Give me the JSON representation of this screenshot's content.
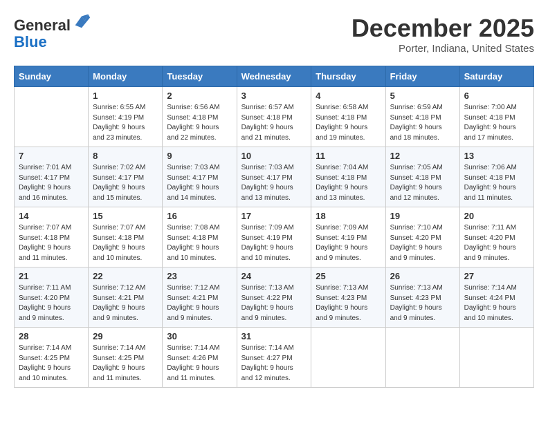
{
  "header": {
    "logo_line1": "General",
    "logo_line2": "Blue",
    "month": "December 2025",
    "location": "Porter, Indiana, United States"
  },
  "days_of_week": [
    "Sunday",
    "Monday",
    "Tuesday",
    "Wednesday",
    "Thursday",
    "Friday",
    "Saturday"
  ],
  "weeks": [
    [
      {
        "day": "",
        "info": ""
      },
      {
        "day": "1",
        "info": "Sunrise: 6:55 AM\nSunset: 4:19 PM\nDaylight: 9 hours\nand 23 minutes."
      },
      {
        "day": "2",
        "info": "Sunrise: 6:56 AM\nSunset: 4:18 PM\nDaylight: 9 hours\nand 22 minutes."
      },
      {
        "day": "3",
        "info": "Sunrise: 6:57 AM\nSunset: 4:18 PM\nDaylight: 9 hours\nand 21 minutes."
      },
      {
        "day": "4",
        "info": "Sunrise: 6:58 AM\nSunset: 4:18 PM\nDaylight: 9 hours\nand 19 minutes."
      },
      {
        "day": "5",
        "info": "Sunrise: 6:59 AM\nSunset: 4:18 PM\nDaylight: 9 hours\nand 18 minutes."
      },
      {
        "day": "6",
        "info": "Sunrise: 7:00 AM\nSunset: 4:18 PM\nDaylight: 9 hours\nand 17 minutes."
      }
    ],
    [
      {
        "day": "7",
        "info": "Sunrise: 7:01 AM\nSunset: 4:17 PM\nDaylight: 9 hours\nand 16 minutes."
      },
      {
        "day": "8",
        "info": "Sunrise: 7:02 AM\nSunset: 4:17 PM\nDaylight: 9 hours\nand 15 minutes."
      },
      {
        "day": "9",
        "info": "Sunrise: 7:03 AM\nSunset: 4:17 PM\nDaylight: 9 hours\nand 14 minutes."
      },
      {
        "day": "10",
        "info": "Sunrise: 7:03 AM\nSunset: 4:17 PM\nDaylight: 9 hours\nand 13 minutes."
      },
      {
        "day": "11",
        "info": "Sunrise: 7:04 AM\nSunset: 4:18 PM\nDaylight: 9 hours\nand 13 minutes."
      },
      {
        "day": "12",
        "info": "Sunrise: 7:05 AM\nSunset: 4:18 PM\nDaylight: 9 hours\nand 12 minutes."
      },
      {
        "day": "13",
        "info": "Sunrise: 7:06 AM\nSunset: 4:18 PM\nDaylight: 9 hours\nand 11 minutes."
      }
    ],
    [
      {
        "day": "14",
        "info": "Sunrise: 7:07 AM\nSunset: 4:18 PM\nDaylight: 9 hours\nand 11 minutes."
      },
      {
        "day": "15",
        "info": "Sunrise: 7:07 AM\nSunset: 4:18 PM\nDaylight: 9 hours\nand 10 minutes."
      },
      {
        "day": "16",
        "info": "Sunrise: 7:08 AM\nSunset: 4:18 PM\nDaylight: 9 hours\nand 10 minutes."
      },
      {
        "day": "17",
        "info": "Sunrise: 7:09 AM\nSunset: 4:19 PM\nDaylight: 9 hours\nand 10 minutes."
      },
      {
        "day": "18",
        "info": "Sunrise: 7:09 AM\nSunset: 4:19 PM\nDaylight: 9 hours\nand 9 minutes."
      },
      {
        "day": "19",
        "info": "Sunrise: 7:10 AM\nSunset: 4:20 PM\nDaylight: 9 hours\nand 9 minutes."
      },
      {
        "day": "20",
        "info": "Sunrise: 7:11 AM\nSunset: 4:20 PM\nDaylight: 9 hours\nand 9 minutes."
      }
    ],
    [
      {
        "day": "21",
        "info": "Sunrise: 7:11 AM\nSunset: 4:20 PM\nDaylight: 9 hours\nand 9 minutes."
      },
      {
        "day": "22",
        "info": "Sunrise: 7:12 AM\nSunset: 4:21 PM\nDaylight: 9 hours\nand 9 minutes."
      },
      {
        "day": "23",
        "info": "Sunrise: 7:12 AM\nSunset: 4:21 PM\nDaylight: 9 hours\nand 9 minutes."
      },
      {
        "day": "24",
        "info": "Sunrise: 7:13 AM\nSunset: 4:22 PM\nDaylight: 9 hours\nand 9 minutes."
      },
      {
        "day": "25",
        "info": "Sunrise: 7:13 AM\nSunset: 4:23 PM\nDaylight: 9 hours\nand 9 minutes."
      },
      {
        "day": "26",
        "info": "Sunrise: 7:13 AM\nSunset: 4:23 PM\nDaylight: 9 hours\nand 9 minutes."
      },
      {
        "day": "27",
        "info": "Sunrise: 7:14 AM\nSunset: 4:24 PM\nDaylight: 9 hours\nand 10 minutes."
      }
    ],
    [
      {
        "day": "28",
        "info": "Sunrise: 7:14 AM\nSunset: 4:25 PM\nDaylight: 9 hours\nand 10 minutes."
      },
      {
        "day": "29",
        "info": "Sunrise: 7:14 AM\nSunset: 4:25 PM\nDaylight: 9 hours\nand 11 minutes."
      },
      {
        "day": "30",
        "info": "Sunrise: 7:14 AM\nSunset: 4:26 PM\nDaylight: 9 hours\nand 11 minutes."
      },
      {
        "day": "31",
        "info": "Sunrise: 7:14 AM\nSunset: 4:27 PM\nDaylight: 9 hours\nand 12 minutes."
      },
      {
        "day": "",
        "info": ""
      },
      {
        "day": "",
        "info": ""
      },
      {
        "day": "",
        "info": ""
      }
    ]
  ]
}
